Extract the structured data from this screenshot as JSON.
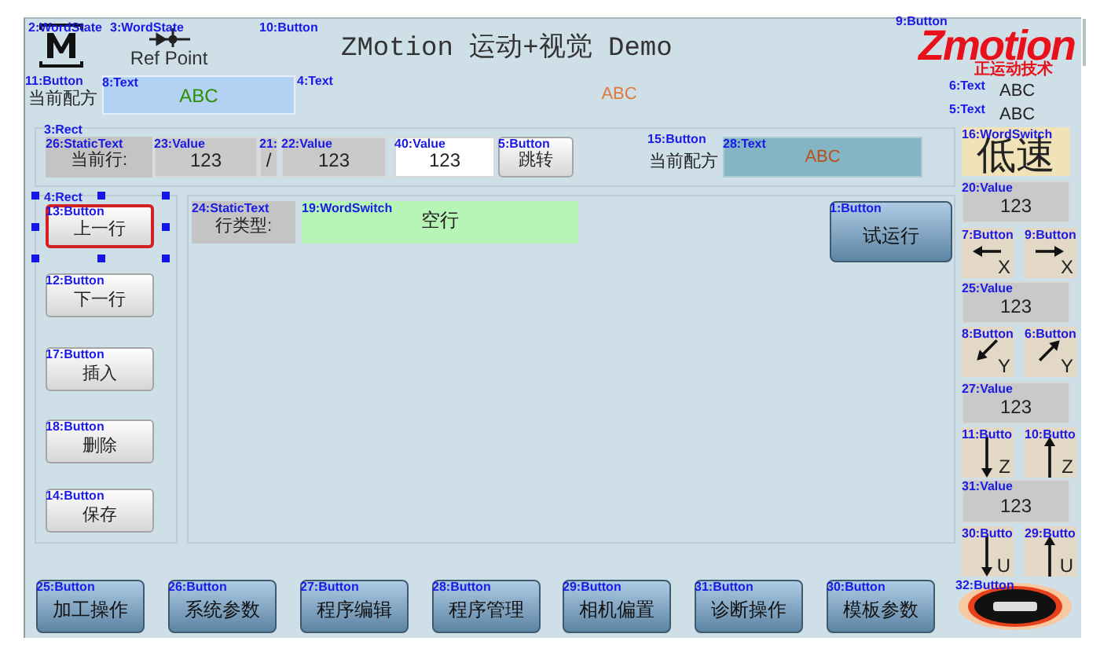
{
  "canvas": {
    "widgets": [
      {
        "kind": "m-icon",
        "tag": "2:WordState",
        "selected": false
      },
      {
        "kind": "refpoint",
        "tag": "3:WordState",
        "text": "Ref Point",
        "selected": false
      },
      {
        "kind": "title",
        "tag": "10:Button",
        "text": "ZMotion 运动+视觉 Demo",
        "selected": false
      },
      {
        "kind": "logo",
        "tag": "9:Button",
        "text": "Zmotion",
        "subtitle": "正运动技术",
        "selected": false
      },
      {
        "kind": "label",
        "tag": "11:Button",
        "text": "当前配方",
        "selected": false
      },
      {
        "kind": "textbox",
        "tag": "8:Text",
        "text": "ABC",
        "selected": false
      },
      {
        "kind": "textbox",
        "tag": "4:Text",
        "text": "ABC",
        "selected": false
      },
      {
        "kind": "textbox",
        "tag": "6:Text",
        "text": "ABC",
        "selected": false
      },
      {
        "kind": "textbox",
        "tag": "5:Text",
        "text": "ABC",
        "selected": false
      },
      {
        "kind": "panel",
        "tag": "3:Rect",
        "selected": false
      },
      {
        "kind": "static",
        "tag": "26:StaticText",
        "text": "当前行:",
        "selected": false
      },
      {
        "kind": "value",
        "tag": "23:Value",
        "text": "123",
        "selected": false
      },
      {
        "kind": "value",
        "tag": "21:",
        "text": "/",
        "selected": false
      },
      {
        "kind": "value",
        "tag": "22:Value",
        "text": "123",
        "selected": false
      },
      {
        "kind": "value",
        "tag": "40:Value",
        "text": "123",
        "selected": false
      },
      {
        "kind": "button",
        "tag": "5:Button",
        "text": "跳转",
        "selected": false
      },
      {
        "kind": "label",
        "tag": "15:Button",
        "text": "当前配方",
        "selected": false
      },
      {
        "kind": "textbox",
        "tag": "28:Text",
        "text": "ABC",
        "selected": false
      },
      {
        "kind": "panel",
        "tag": "4:Rect",
        "selected": false
      },
      {
        "kind": "panel",
        "selected": false
      },
      {
        "kind": "switch",
        "tag": "16:WordSwitch",
        "text": "低速",
        "selected": false
      },
      {
        "kind": "value",
        "tag": "20:Value",
        "text": "123",
        "selected": false
      },
      {
        "kind": "jog",
        "tag": "7:Button",
        "text": "X",
        "selected": false
      },
      {
        "kind": "jog",
        "tag": "9:Button",
        "text": "X",
        "selected": false
      },
      {
        "kind": "value",
        "tag": "25:Value",
        "text": "123",
        "selected": false
      },
      {
        "kind": "jog",
        "tag": "8:Button",
        "text": "Y",
        "selected": false
      },
      {
        "kind": "jog",
        "tag": "6:Button",
        "text": "Y",
        "selected": false
      },
      {
        "kind": "value",
        "tag": "27:Value",
        "text": "123",
        "selected": false
      },
      {
        "kind": "jog",
        "tag": "11:Butto",
        "text": "Z",
        "selected": false
      },
      {
        "kind": "jog",
        "tag": "10:Butto",
        "text": "Z",
        "selected": false
      },
      {
        "kind": "value",
        "tag": "31:Value",
        "text": "123",
        "selected": false
      },
      {
        "kind": "jog",
        "tag": "30:Butto",
        "text": "U",
        "selected": false
      },
      {
        "kind": "jog",
        "tag": "29:Butto",
        "text": "U",
        "selected": false
      },
      {
        "kind": "badge",
        "tag": "32:Button",
        "selected": false
      },
      {
        "kind": "button",
        "tag": "13:Button",
        "text": "上一行",
        "selected": true
      },
      {
        "kind": "button",
        "tag": "12:Button",
        "text": "下一行",
        "selected": false
      },
      {
        "kind": "button",
        "tag": "17:Button",
        "text": "插入",
        "selected": false
      },
      {
        "kind": "button",
        "tag": "18:Button",
        "text": "删除",
        "selected": false
      },
      {
        "kind": "button",
        "tag": "14:Button",
        "text": "保存",
        "selected": false
      },
      {
        "kind": "static",
        "tag": "24:StaticText",
        "text": "行类型:",
        "selected": false
      },
      {
        "kind": "switch",
        "tag": "19:WordSwitch",
        "text": "空行",
        "selected": false
      },
      {
        "kind": "navbutton",
        "tag": "1:Button",
        "text": "试运行",
        "selected": false
      },
      {
        "kind": "navbutton",
        "tag": "25:Button",
        "text": "加工操作",
        "selected": false
      },
      {
        "kind": "navbutton",
        "tag": "26:Button",
        "text": "系统参数",
        "selected": false
      },
      {
        "kind": "navbutton",
        "tag": "27:Button",
        "text": "程序编辑",
        "selected": false
      },
      {
        "kind": "navbutton",
        "tag": "28:Button",
        "text": "程序管理",
        "selected": false
      },
      {
        "kind": "navbutton",
        "tag": "29:Button",
        "text": "相机偏置",
        "selected": false
      },
      {
        "kind": "navbutton",
        "tag": "31:Button",
        "text": "诊断操作",
        "selected": false
      },
      {
        "kind": "navbutton",
        "tag": "30:Button",
        "text": "模板参数",
        "selected": false
      }
    ]
  }
}
